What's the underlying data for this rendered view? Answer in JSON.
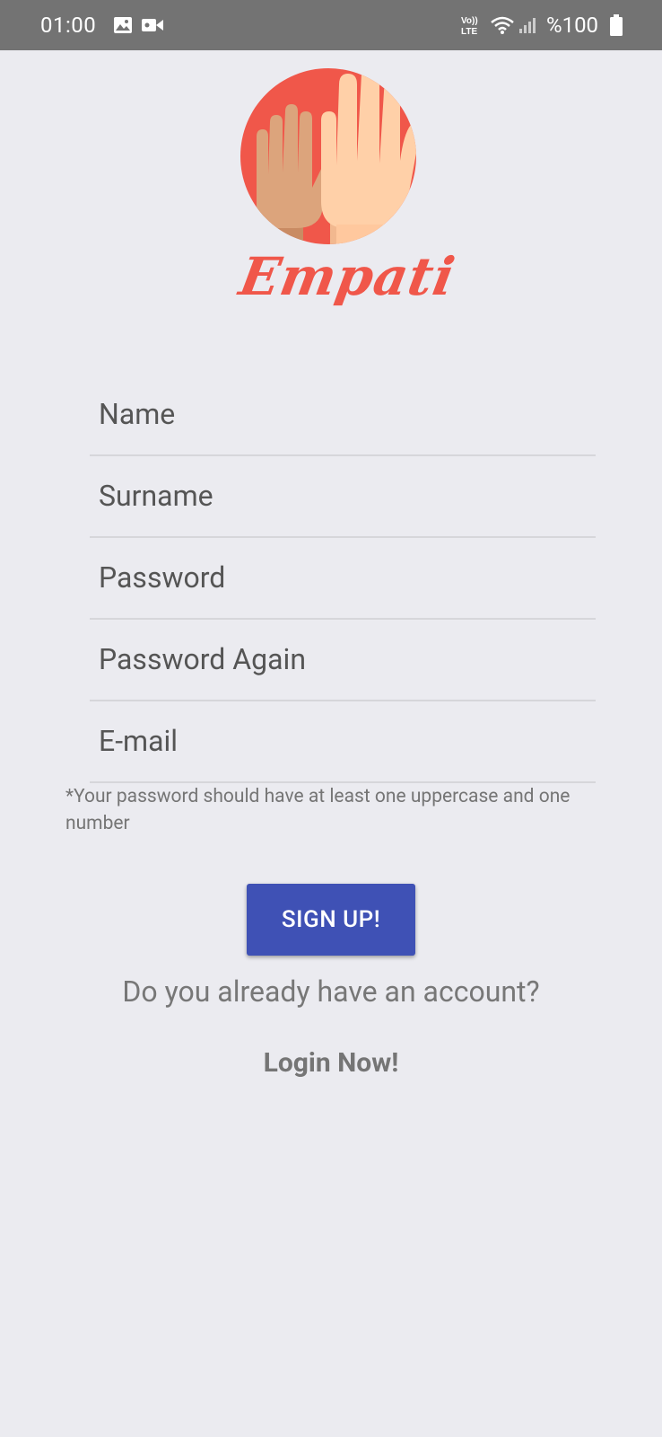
{
  "status_bar": {
    "time": "01:00",
    "battery": "%100",
    "network": "LTE"
  },
  "brand": {
    "name": "Empati"
  },
  "form": {
    "name_placeholder": "Name",
    "surname_placeholder": "Surname",
    "password_placeholder": "Password",
    "password_again_placeholder": "Password Again",
    "email_placeholder": "E-mail",
    "password_hint": "*Your password should have at least one uppercase and one number"
  },
  "actions": {
    "signup_label": "SIGN UP!",
    "account_question": "Do you already have an account?",
    "login_label": "Login Now!"
  },
  "colors": {
    "primary": "#3F51B5",
    "brand": "#F0574A",
    "background": "#EBEBF0"
  }
}
